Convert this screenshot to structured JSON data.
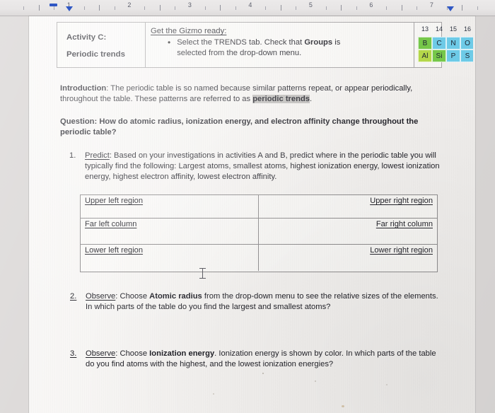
{
  "ruler": {
    "numbers": [
      "1",
      "2",
      "3",
      "4",
      "5",
      "6",
      "7"
    ],
    "first_line_indent_marker": "first-line-indent",
    "left_indent_marker": "left-indent",
    "right_indent_marker": "right-indent"
  },
  "activity": {
    "title_line1": "Activity C:",
    "title_line2": "Periodic trends",
    "gizmo_heading": "Get the Gizmo ready:",
    "bullet_dot": "•",
    "bullet_text_part1": "Select the TRENDS tab. Check that ",
    "bullet_text_bold": "Groups",
    "bullet_text_part2": " is selected from the drop-down menu."
  },
  "periodic_table": {
    "group_headers": [
      "13",
      "14",
      "15",
      "16"
    ],
    "row1": [
      "B",
      "C",
      "N",
      "O"
    ],
    "row2": [
      "Al",
      "Si",
      "P",
      "S"
    ],
    "colors": {
      "green": "#76c84a",
      "yellow_green": "#b5d84a",
      "cyan": "#6ecbe8",
      "light_cyan": "#8fd6ea"
    },
    "row1_colors": [
      "green",
      "cyan",
      "cyan",
      "cyan"
    ],
    "row2_colors": [
      "yellow_green",
      "green",
      "cyan",
      "cyan"
    ]
  },
  "introduction": {
    "label": "Introduction",
    "text_part1": ": The periodic table is so named because similar patterns repeat, or appear periodically, throughout the table. These patterns are referred to as ",
    "highlighted_term": "periodic trends",
    "text_part2": "."
  },
  "question": {
    "text": "Question: How do atomic radius, ionization energy, and electron affinity change throughout the periodic table?"
  },
  "items": [
    {
      "number": "1.",
      "label": "Predict",
      "text": ": Based on your investigations in activities A and B, predict where in the periodic table you will typically find the following: Largest atoms, smallest atoms, highest ionization energy, lowest ionization energy, highest electron affinity, lowest electron affinity."
    },
    {
      "number": "2.",
      "label": "Observe",
      "text_part1": ": Choose ",
      "bold_term": "Atomic radius",
      "text_part2": " from the drop-down menu to see the relative sizes of the elements. In which parts of the table do you find the largest and smallest atoms?"
    },
    {
      "number": "3.",
      "label": "Observe",
      "text_part1": ": Choose ",
      "bold_term": "Ionization energy",
      "text_part2": ". Ionization energy is shown by color. In which parts of the table do you find atoms with the highest, and the lowest ionization energies?"
    }
  ],
  "answer_table": {
    "rows": [
      {
        "left": "Upper left region",
        "right": "Upper right region"
      },
      {
        "left": "Far left column",
        "right": "Far right column"
      },
      {
        "left": "Lower left region",
        "right": "Lower right region"
      }
    ]
  },
  "cursor": {
    "type": "text-ibeam"
  }
}
